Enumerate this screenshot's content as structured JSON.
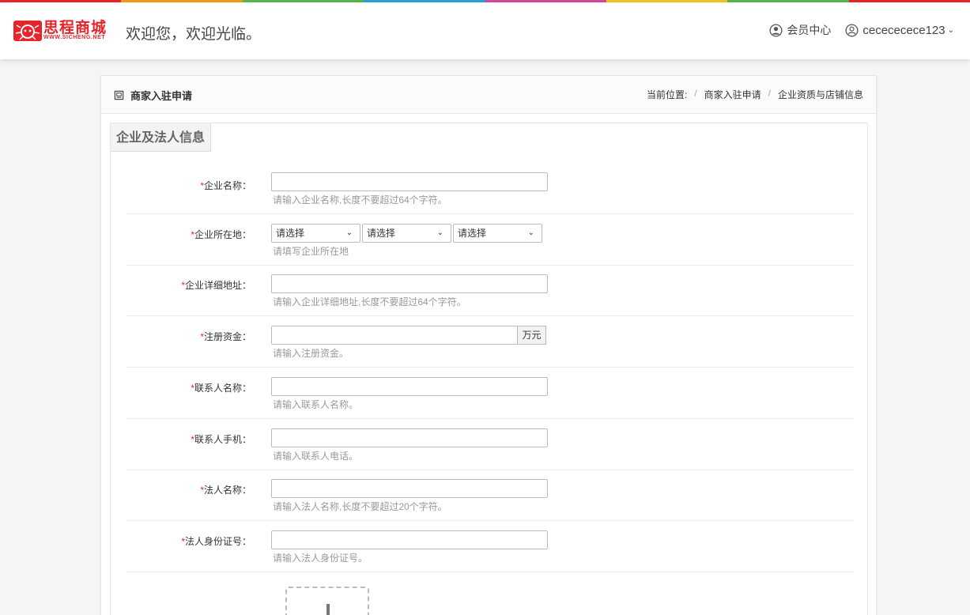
{
  "colors": {
    "brand": "#e8242a",
    "rainbow": [
      "#e8242a",
      "#f19a1a",
      "#56b849",
      "#2aa1d9",
      "#d9469c",
      "#f5c41a",
      "#56b849",
      "#2aa1d9"
    ]
  },
  "header": {
    "logo_text": "思程商城",
    "logo_sub": "WWW.SICHENG.NET",
    "welcome": "欢迎您，欢迎光临。",
    "member_center": "会员中心",
    "username": "cecececece123"
  },
  "panel": {
    "title": "商家入驻申请",
    "breadcrumb": {
      "label": "当前位置:",
      "items": [
        "商家入驻申请",
        "企业资质与店铺信息"
      ]
    }
  },
  "section": {
    "title": "企业及法人信息"
  },
  "form": {
    "required_mark": "*",
    "company_name": {
      "label": "企业名称：",
      "value": "",
      "hint": "请输入企业名称,长度不要超过64个字符。"
    },
    "location": {
      "label": "企业所在地：",
      "selects": [
        "请选择",
        "请选择",
        "请选择"
      ],
      "hint": "请填写企业所在地"
    },
    "address": {
      "label": "企业详细地址：",
      "value": "",
      "hint": "请输入企业详细地址,长度不要超过64个字符。"
    },
    "capital": {
      "label": "注册资金：",
      "value": "",
      "unit": "万元",
      "hint": "请输入注册资金。"
    },
    "contact_name": {
      "label": "联系人名称：",
      "value": "",
      "hint": "请输入联系人名称。"
    },
    "contact_phone": {
      "label": "联系人手机：",
      "value": "",
      "hint": "请输入联系人电话。"
    },
    "legal_name": {
      "label": "法人名称：",
      "value": "",
      "hint": "请输入法人名称,长度不要超过20个字符。"
    },
    "legal_id": {
      "label": "法人身份证号：",
      "value": "",
      "hint": "请输入法人身份证号。"
    }
  }
}
